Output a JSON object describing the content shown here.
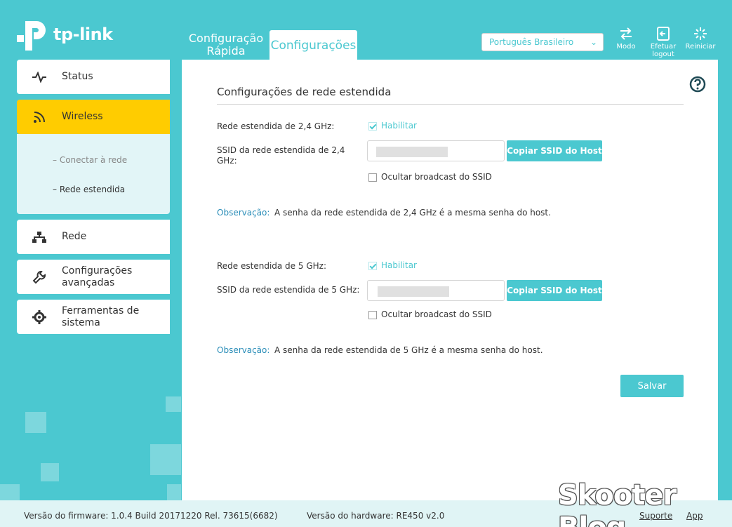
{
  "brand": {
    "name": "tp-link"
  },
  "header": {
    "tabs": [
      {
        "label": "Configuração Rápida"
      },
      {
        "label": "Configurações",
        "active": true
      }
    ],
    "language": {
      "selected": "Português Brasileiro"
    },
    "tools": [
      {
        "label": "Modo",
        "icon": "mode-icon"
      },
      {
        "label": "Efetuar logout",
        "icon": "logout-icon"
      },
      {
        "label": "Reiniciar",
        "icon": "reboot-icon"
      }
    ]
  },
  "sidebar": {
    "items": [
      {
        "label": "Status",
        "icon": "status-icon"
      },
      {
        "label": "Wireless",
        "icon": "wireless-icon",
        "active": true
      },
      {
        "label": "Rede",
        "icon": "network-icon"
      },
      {
        "label": "Configurações avançadas",
        "icon": "wrench-icon"
      },
      {
        "label": "Ferramentas de sistema",
        "icon": "gear-icon"
      }
    ],
    "subitems": [
      {
        "label": "Conectar à rede"
      },
      {
        "label": "Rede estendida",
        "active": true
      }
    ]
  },
  "main": {
    "title": "Configurações de rede estendida",
    "band24": {
      "enable_label": "Rede estendida de 2,4 GHz:",
      "enable_checkbox": "Habilitar",
      "enabled": true,
      "ssid_label": "SSID da rede estendida de 2,4 GHz:",
      "copy_button": "Copiar SSID do Host",
      "hide_label": "Ocultar broadcast do SSID",
      "hidden": false,
      "note_key": "Observação:",
      "note_text": "A senha da rede estendida de 2,4 GHz é a mesma senha do host."
    },
    "band5": {
      "enable_label": "Rede estendida de 5 GHz:",
      "enable_checkbox": "Habilitar",
      "enabled": true,
      "ssid_label": "SSID da rede estendida de 5 GHz:",
      "copy_button": "Copiar SSID do Host",
      "hide_label": "Ocultar broadcast do SSID",
      "hidden": false,
      "note_key": "Observação:",
      "note_text": "A senha da rede estendida de 5 GHz é a mesma senha do host."
    },
    "save_button": "Salvar"
  },
  "footer": {
    "firmware": "Versão do firmware: 1.0.4 Build 20171220 Rel. 73615(6682)",
    "hardware": "Versão do hardware: RE450 v2.0",
    "support": "Suporte",
    "app": "App"
  },
  "watermark": "Skooter Blog",
  "colors": {
    "accent": "#4bc8d0",
    "active": "#ffcc00",
    "note": "#2a8db8"
  }
}
